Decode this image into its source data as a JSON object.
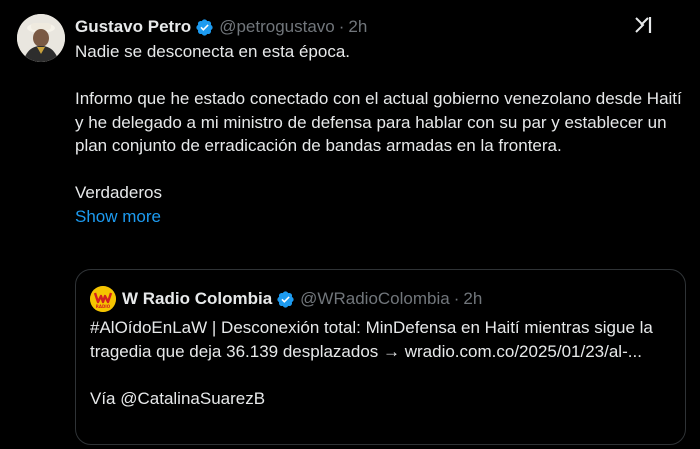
{
  "tweet": {
    "author_name": "Gustavo Petro",
    "handle": "@petrogustavo",
    "separator": "·",
    "time": "2h",
    "paragraphs": [
      "Nadie se desconecta en esta época.",
      "Informo que he estado conectado con el actual gobierno venezolano desde Haití y he delegado a mi ministro de defensa para hablar con su par y establecer un plan conjunto de erradicación de bandas armadas en la frontera.",
      "Verdaderos"
    ],
    "show_more": "Show more",
    "icons": {
      "verified": "verified-badge-icon",
      "menu": "grok-icon"
    }
  },
  "quoted_tweet": {
    "author_name": "W Radio Colombia",
    "handle": "@WRadioColombia",
    "separator": "·",
    "time": "2h",
    "lines": [
      "#AlOídoEnLaW | Desconexión total: MinDefensa en Haití mientras sigue la tragedia que deja 36.139 desplazados → wradio.com.co/2025/01/23/al-...",
      "Vía @CatalinaSuarezB"
    ],
    "logo_text": "RADIO"
  },
  "colors": {
    "background": "#000000",
    "text": "#e7e9ea",
    "muted": "#71767b",
    "link": "#1d9bf0",
    "verified": "#1d9bf0",
    "border": "#2f3336",
    "w_radio_yellow": "#f5c400"
  }
}
